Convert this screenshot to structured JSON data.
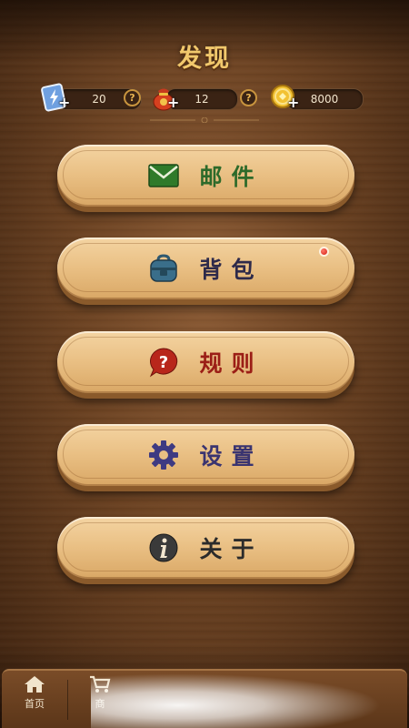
{
  "header": {
    "title": "发现"
  },
  "resources": [
    {
      "name": "energy",
      "icon": "energy-card-icon",
      "value": "20"
    },
    {
      "name": "bag",
      "icon": "lucky-bag-icon",
      "value": "12"
    },
    {
      "name": "coins",
      "icon": "gold-coin-icon",
      "value": "8000"
    }
  ],
  "help_label": "?",
  "plus_label": "+",
  "menu": [
    {
      "id": "mail",
      "label": "邮件",
      "icon": "envelope-icon",
      "color": "#2d6a2a"
    },
    {
      "id": "backpack",
      "label": "背包",
      "icon": "backpack-icon",
      "color": "#2e2a4a",
      "badge": true
    },
    {
      "id": "rules",
      "label": "规则",
      "icon": "question-bubble-icon",
      "color": "#9b1e16"
    },
    {
      "id": "settings",
      "label": "设置",
      "icon": "gear-icon",
      "color": "#3a3470"
    },
    {
      "id": "about",
      "label": "关于",
      "icon": "info-icon",
      "color": "#2b2b2b"
    }
  ],
  "tabbar": {
    "tabs": [
      {
        "label": "首页",
        "icon": "home-icon"
      },
      {
        "label": "商",
        "icon": "cart-icon"
      }
    ]
  }
}
